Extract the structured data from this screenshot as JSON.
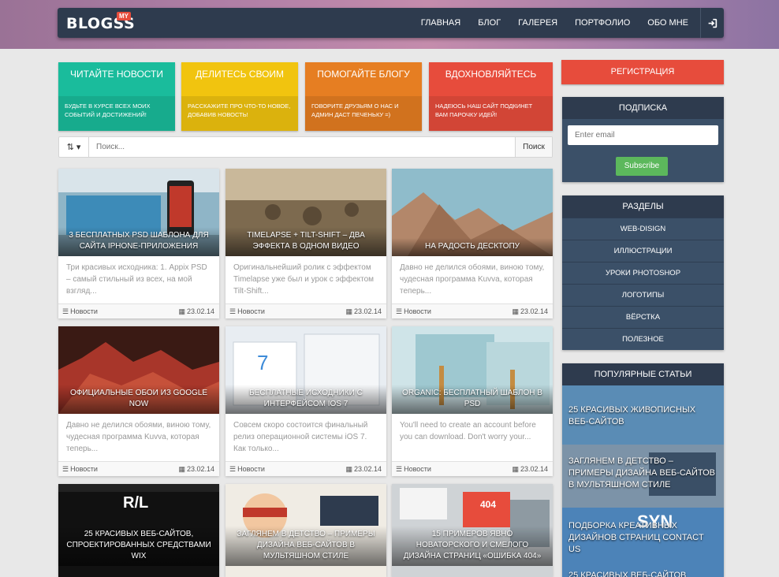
{
  "nav": {
    "logo": "BLOGSS",
    "logo_badge": "MY",
    "links": [
      "ГЛАВНАЯ",
      "БЛОГ",
      "ГАЛЕРЕЯ",
      "ПОРТФОЛИО",
      "ОБО МНЕ"
    ],
    "login_icon": "sign-in-icon"
  },
  "features": [
    {
      "title": "ЧИТАЙТЕ НОВОСТИ",
      "text": "БУДЬТЕ В КУРСЕ ВСЕХ МОИХ СОБЫТИЙ И ДОСТИЖЕНИЙ!",
      "color": "#1abc9c"
    },
    {
      "title": "ДЕЛИТЕСЬ СВОИМ",
      "text": "РАССКАЖИТЕ ПРО ЧТО-ТО НОВОЕ, ДОБАВИВ НОВОСТЬ!",
      "color": "#f1c40f"
    },
    {
      "title": "ПОМОГАЙТЕ БЛОГУ",
      "text": "ГОВОРИТЕ ДРУЗЬЯМ О НАС И АДМИН ДАСТ ПЕЧЕНЬКУ =)",
      "color": "#e67e22"
    },
    {
      "title": "ВДОХНОВЛЯЙТЕСЬ",
      "text": "НАДЕЮСЬ НАШ САЙТ ПОДКИНЕТ ВАМ ПАРОЧКУ ИДЕЙ!",
      "color": "#e74c3c"
    }
  ],
  "search": {
    "sort_label": "⇅ ▾",
    "placeholder": "Поиск...",
    "button": "Поиск"
  },
  "cards": [
    {
      "title": "3 БЕСПЛАТНЫХ PSD ШАБЛОНА ДЛЯ САЙТА IPHONE-ПРИЛОЖЕНИЯ",
      "text": "Три красивых исходника: 1. Appix PSD – самый стильный из всех, на мой взгляд...",
      "category": "Новости",
      "date": "23.02.14"
    },
    {
      "title": "TIMELAPSE + TILT-SHIFT – ДВА ЭФФЕКТА В ОДНОМ ВИДЕО",
      "text": "Оригинальнейший ролик с эффектом Timelapse уже был и урок с эффектом Tilt-Shift...",
      "category": "Новости",
      "date": "23.02.14"
    },
    {
      "title": "НА РАДОСТЬ ДЕСКТОПУ",
      "text": "Давно не делился обоями, виною тому, чудесная программа Kuvva, которая теперь...",
      "category": "Новости",
      "date": "23.02.14"
    },
    {
      "title": "ОФИЦИАЛЬНЫЕ ОБОИ ИЗ GOOGLE NOW",
      "text": "Давно не делился обоями, виною тому, чудесная программа Kuvva, которая теперь...",
      "category": "Новости",
      "date": "23.02.14"
    },
    {
      "title": "БЕСПЛАТНЫЕ ИСХОДНИКИ С ИНТЕРФЕЙСОМ IOS 7",
      "text": "Совсем скоро состоится финальный релиз операционной системы iOS 7. Как только...",
      "category": "Новости",
      "date": "23.02.14"
    },
    {
      "title": "ORGANIC: БЕСПЛАТНЫЙ ШАБЛОН В PSD",
      "text": "You'll need to create an account before you can download. Don't worry your...",
      "category": "Новости",
      "date": "23.02.14"
    },
    {
      "title": "25 КРАСИВЫХ ВЕБ-САЙТОВ, СПРОЕКТИРОВАННЫХ СРЕДСТВАМИ WIX",
      "text": "",
      "category": "",
      "date": ""
    },
    {
      "title": "ЗАГЛЯНЕМ В ДЕТСТВО – ПРИМЕРЫ ДИЗАЙНА ВЕБ-САЙТОВ В МУЛЬТЯШНОМ СТИЛЕ",
      "text": "",
      "category": "",
      "date": ""
    },
    {
      "title": "15 ПРИМЕРОВ ЯВНО НОВАТОРСКОГО И СМЕЛОГО ДИЗАЙНА СТРАНИЦ «ОШИБКА 404»",
      "text": "",
      "category": "",
      "date": ""
    }
  ],
  "sidebar": {
    "register": "РЕГИСТРАЦИЯ",
    "subscribe": {
      "title": "ПОДПИСКА",
      "placeholder": "Enter email",
      "button": "Subscribe"
    },
    "sections": {
      "title": "РАЗДЕЛЫ",
      "items": [
        "WEB-DISIGN",
        "ИЛЛЮСТРАЦИИ",
        "УРОКИ PHOTOSHOP",
        "ЛОГОТИПЫ",
        "ВЁРСТКА",
        "ПОЛЕЗНОЕ"
      ]
    },
    "popular": {
      "title": "ПОПУЛЯРНЫЕ СТАТЬИ",
      "items": [
        "25 КРАСИВЫХ ЖИВОПИСНЫХ ВЕБ-САЙТОВ",
        "ЗАГЛЯНЕМ В ДЕТСТВО – ПРИМЕРЫ ДИЗАЙНА ВЕБ-САЙТОВ В МУЛЬТЯШНОМ СТИЛЕ",
        "ПОДБОРКА КРЕАТИВНЫХ ДИЗАЙНОВ СТРАНИЦ CONTACT US",
        "25 КРАСИВЫХ ВЕБ-САЙТОВ"
      ]
    }
  },
  "card_icons": {
    "category": "list-icon",
    "date": "calendar-icon"
  },
  "colors": {
    "nav_bg": "#2e3b4e",
    "widget_bg": "#3b5068",
    "register": "#e74c3c",
    "subscribe_btn": "#5cb85c"
  }
}
